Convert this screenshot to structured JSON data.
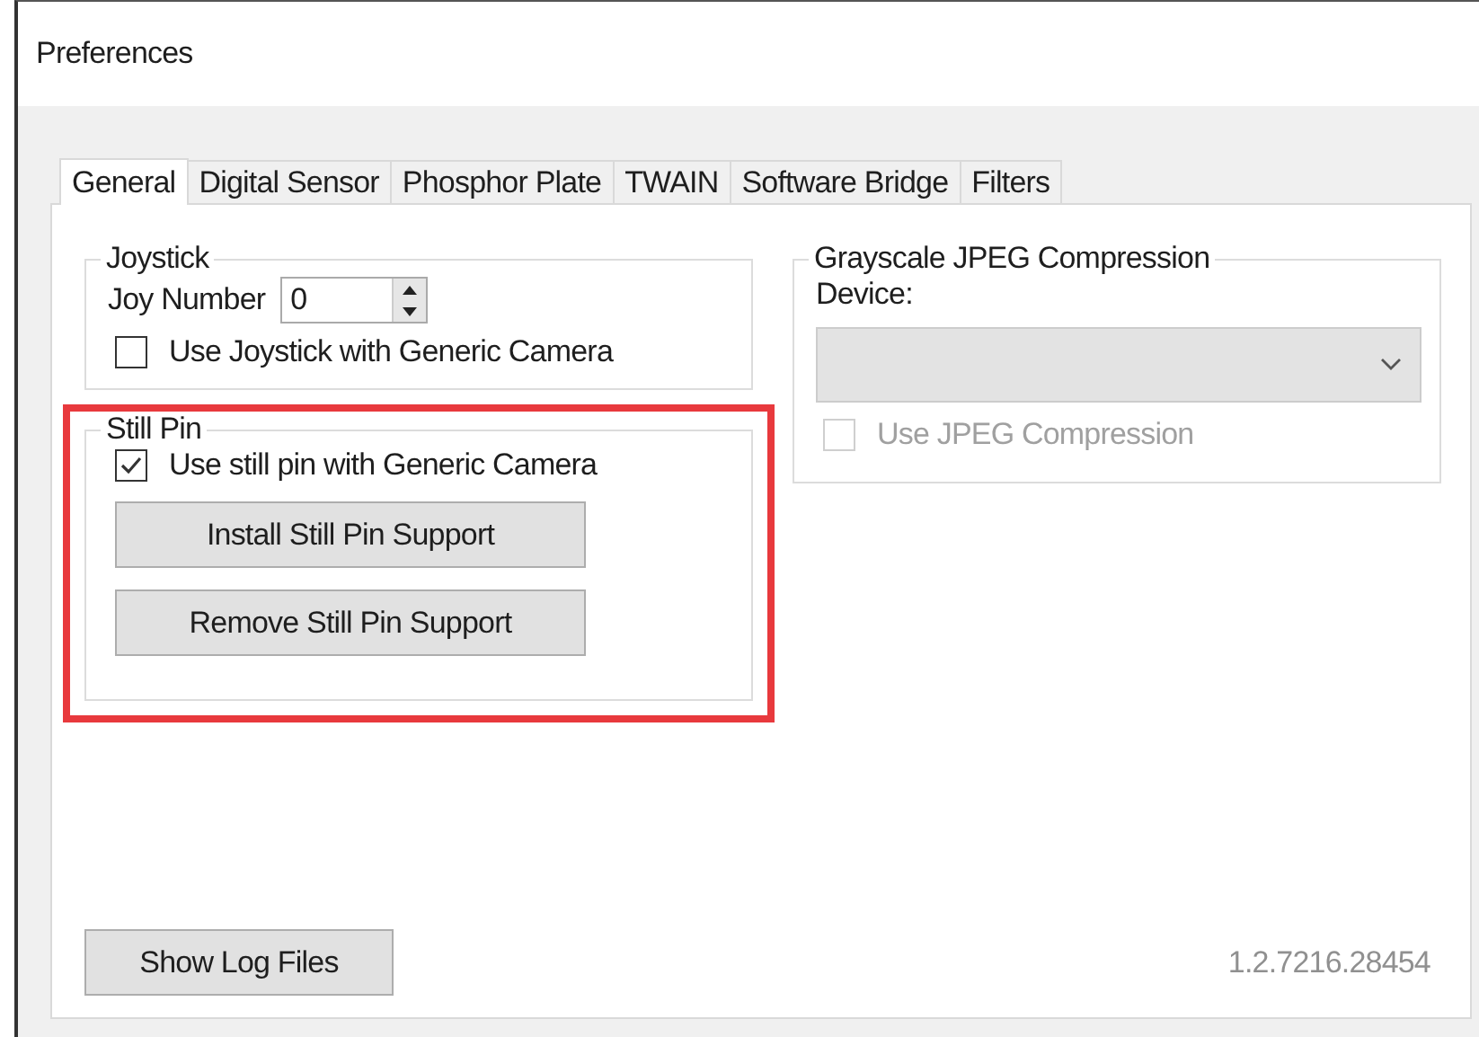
{
  "window": {
    "title": "Preferences"
  },
  "tabs": [
    {
      "label": "General",
      "selected": true
    },
    {
      "label": "Digital Sensor",
      "selected": false
    },
    {
      "label": "Phosphor Plate",
      "selected": false
    },
    {
      "label": "TWAIN",
      "selected": false
    },
    {
      "label": "Software Bridge",
      "selected": false
    },
    {
      "label": "Filters",
      "selected": false
    }
  ],
  "joystick": {
    "title": "Joystick",
    "joy_number": {
      "label": "Joy Number",
      "value": "0"
    },
    "checkbox": {
      "label": "Use Joystick with Generic Camera",
      "checked": false,
      "disabled": false
    }
  },
  "still_pin": {
    "title": "Still Pin",
    "highlighted": true,
    "checkbox": {
      "label": "Use still pin with Generic Camera",
      "checked": true,
      "disabled": false
    },
    "buttons": [
      "Install Still Pin Support",
      "Remove Still Pin Support"
    ]
  },
  "jpeg": {
    "title": "Grayscale JPEG Compression",
    "device_label": "Device:",
    "device_disabled": true,
    "checkbox": {
      "label": "Use JPEG Compression",
      "checked": false,
      "disabled": true
    }
  },
  "footer": {
    "button": "Show Log Files",
    "version": "1.2.7216.28454"
  }
}
